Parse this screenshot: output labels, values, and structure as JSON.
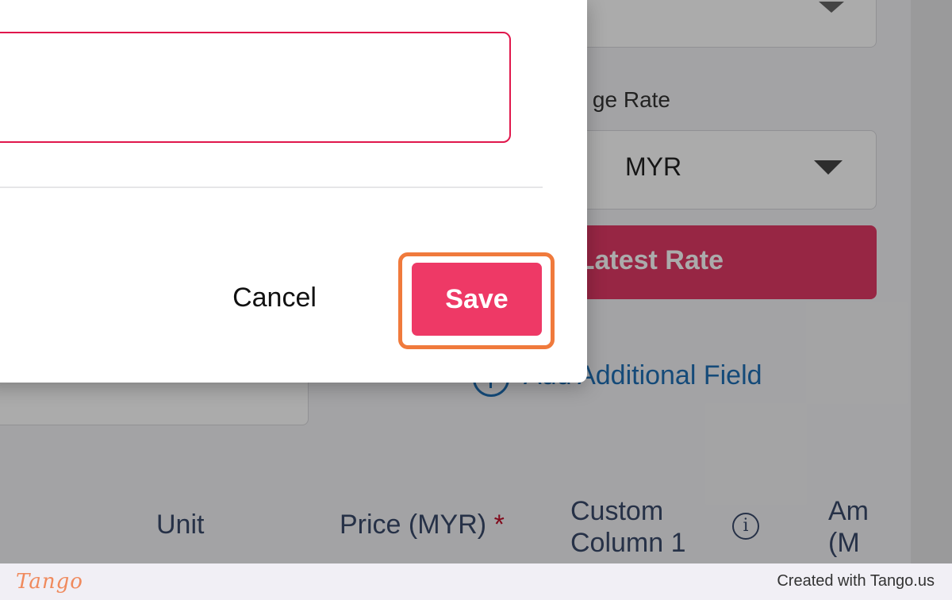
{
  "background_form": {
    "exchange_rate_label": "ge Rate",
    "currency_value": "MYR",
    "latest_rate_button": "Latest Rate",
    "add_field_link": "Add Additional Field",
    "columns": {
      "unit": "Unit",
      "price": "Price (MYR)",
      "price_required": "*",
      "custom_line1": "Custom",
      "custom_line2": "Column 1",
      "amount_line1": "Am",
      "amount_line2": "(M"
    },
    "info_icon_glyph": "i"
  },
  "dialog": {
    "input_value": "",
    "cancel_label": "Cancel",
    "save_label": "Save"
  },
  "footer": {
    "logo": "Tango",
    "credit": "Created with Tango.us"
  },
  "colors": {
    "primary": "#ee3966",
    "input_error_border": "#e0174c",
    "highlight": "#f07a3c",
    "link": "#1e6fb5"
  }
}
